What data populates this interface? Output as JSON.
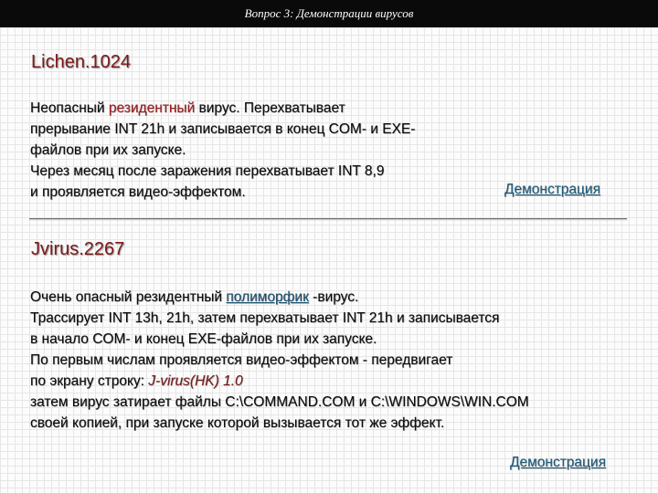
{
  "title": "Вопрос 3: Демонстрации вирусов",
  "section1": {
    "heading": "Lichen.1024",
    "line1_pre": "  Неопасный ",
    "line1_hl": "резидентный",
    "line1_post": " вирус. Перехватывает",
    "line2": "прерывание INT 21h и записывается в конец COM- и EXE-",
    "line3": "файлов при их запуске.",
    "line4": "Через месяц после заражения перехватывает INT 8,9",
    "line5": "и проявляется видео-эффектом.",
    "demo_label": "Демонстрация"
  },
  "section2": {
    "heading": "Jvirus.2267",
    "line1_pre": " Очень опасный резидентный ",
    "line1_hl": "полиморфик",
    "line1_post": " -вирус.",
    "line2": "Трассирует INT 13h, 21h, затем перехватывает INT 21h и записывается",
    "line3": "в начало COM- и конец EXE-файлов при их запуске.",
    "line4": "По первым числам проявляется видео-эффектом - передвигает",
    "line5_pre": "по экрану строку:  ",
    "line5_hl": "J-virus(HK) 1.0",
    "line6": "затем вирус затирает файлы C:\\COMMAND.COM и C:\\WINDOWS\\WIN.COM",
    "line7": "своей копией, при запуске которой вызывается тот же эффект.",
    "demo_label": "Демонстрация"
  }
}
